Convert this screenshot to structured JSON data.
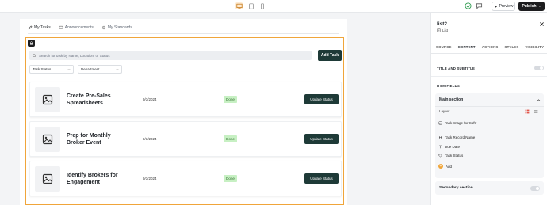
{
  "toolbar": {
    "preview_label": "Preview",
    "publish_label": "Publish"
  },
  "page": {
    "tabs": [
      {
        "label": "My Tasks"
      },
      {
        "label": "Announcements"
      },
      {
        "label": "My Standards"
      }
    ],
    "search": {
      "placeholder": "Search for task by Name, Location, or Status"
    },
    "add_task_label": "Add Task",
    "filters": [
      {
        "label": "Task Status"
      },
      {
        "label": "Department"
      }
    ],
    "tasks": [
      {
        "title": "Create Pre-Sales Spreadsheets",
        "date": "9/3/2024",
        "status": "Done",
        "action": "Update Status"
      },
      {
        "title": "Prep for Monthly Broker Event",
        "date": "9/3/2024",
        "status": "Done",
        "action": "Update Status"
      },
      {
        "title": "Identify Brokers for Engagement",
        "date": "9/3/2024",
        "status": "Done",
        "action": "Update Status"
      }
    ]
  },
  "panel": {
    "title": "list2",
    "subtitle": "List",
    "tabs": [
      "SOURCE",
      "CONTENT",
      "ACTIONS",
      "STYLES",
      "VISIBILITY"
    ],
    "active_tab": "CONTENT",
    "title_and_subtitle_label": "TITLE AND SUBTITLE",
    "item_fields_label": "ITEM FIELDS",
    "main_section": {
      "title": "Main section",
      "layout_label": "Layout",
      "fields": [
        {
          "label": "Task Image for Softr",
          "icon": "image-icon"
        },
        {
          "label": "Task Record Name",
          "icon": "heading-icon"
        },
        {
          "label": "Due Date",
          "icon": "text-icon"
        },
        {
          "label": "Task Status",
          "icon": "tag-icon"
        }
      ],
      "add_label": "Add"
    },
    "secondary_section_label": "Secondary section"
  },
  "colors": {
    "accent": "#f0a53a",
    "button_dark": "#1e3a37",
    "status_done_bg": "#c7f0c3",
    "publish_bg": "#1d1d1f"
  }
}
